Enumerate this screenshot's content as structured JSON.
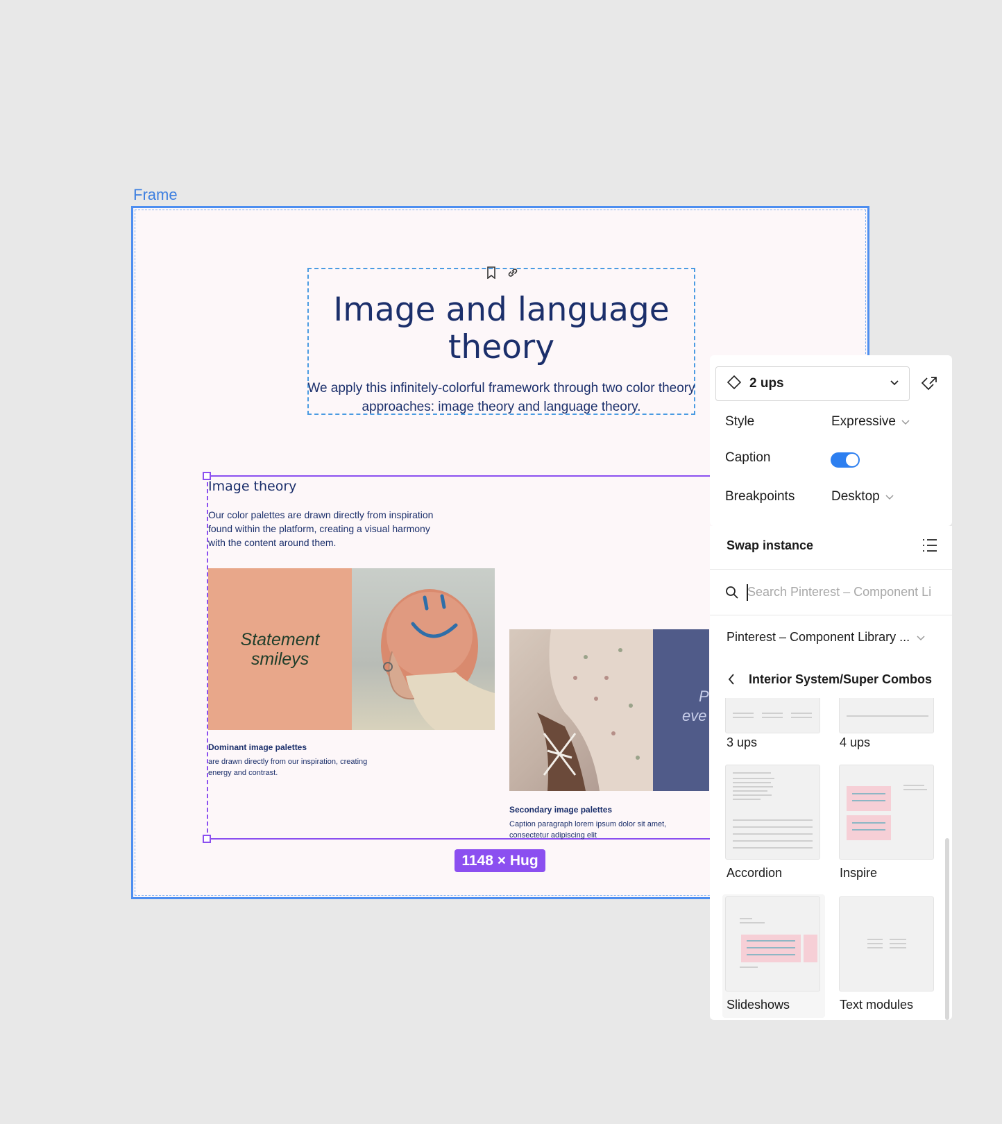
{
  "frame": {
    "label": "Frame"
  },
  "header": {
    "title": "Image and language theory",
    "subtitle": "We apply this infinitely-colorful framework through two color theory approaches: image theory and language theory."
  },
  "content": {
    "section_title": "Image theory",
    "section_body": "Our color palettes are drawn directly from inspiration found within the platform, creating a visual harmony with the content around them.",
    "card1": {
      "overlay_text": "Statement smileys",
      "caption_title": "Dominant image palettes",
      "caption_body": "are drawn directly from our inspiration, creating energy and contrast."
    },
    "card2": {
      "overlay_text_1": "P",
      "overlay_text_2": "eve",
      "caption_title": "Secondary image palettes",
      "caption_body": "Caption paragraph lorem ipsum dolor sit amet, consectetur adipiscing elit"
    },
    "size_badge": "1148 × Hug"
  },
  "properties": {
    "variant": "2 ups",
    "style_label": "Style",
    "style_value": "Expressive",
    "caption_label": "Caption",
    "caption_on": true,
    "breakpoints_label": "Breakpoints",
    "breakpoints_value": "Desktop"
  },
  "swap": {
    "title": "Swap instance",
    "search_placeholder": "Search Pinterest – Component Li",
    "library": "Pinterest – Component Library ...",
    "breadcrumb": "Interior System/Super Combos",
    "items": [
      "3 ups",
      "4 ups",
      "Accordion",
      "Inspire",
      "Slideshows",
      "Text modules"
    ]
  },
  "colors": {
    "frame_border": "#4d8ef0",
    "selection": "#8b4ff0",
    "title_text": "#1b2f6b",
    "toggle_on": "#2d7ff0"
  }
}
